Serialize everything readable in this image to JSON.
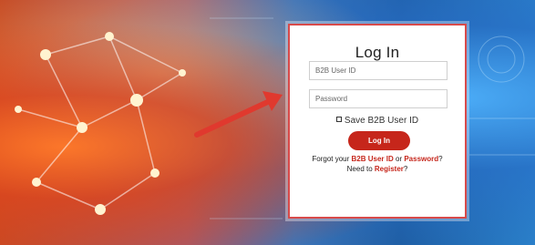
{
  "login": {
    "title": "Log In",
    "user_placeholder": "B2B User ID",
    "password_placeholder": "Password",
    "save_label": "Save B2B User ID",
    "button_label": "Log In",
    "forgot_prefix": "Forgot your ",
    "forgot_user_link": "B2B User ID",
    "forgot_or": " or ",
    "forgot_password_link": "Password",
    "forgot_suffix": "?",
    "register_prefix": "Need to ",
    "register_link": "Register",
    "register_suffix": "?"
  },
  "colors": {
    "accent": "#c6261b",
    "panel_border": "#d84a4a"
  }
}
